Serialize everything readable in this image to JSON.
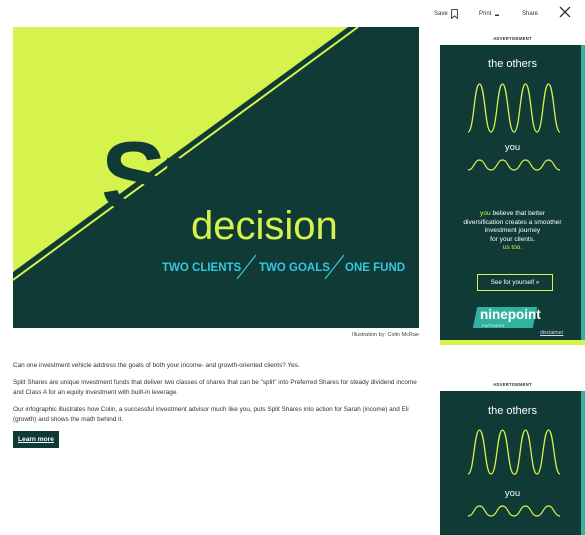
{
  "toolbar": {
    "save_label": "Save",
    "print_label": "Print",
    "share_label": "Share",
    "save_icon": "bookmark-icon",
    "print_icon": "print-icon",
    "x_icon": "x-logo-icon"
  },
  "hero": {
    "title_word_1": "Split",
    "title_word_2": "decision",
    "tagline_1": "TWO CLIENTS",
    "tagline_2": "TWO GOALS",
    "tagline_3": "ONE FUND",
    "caption": "Illustration by: Colin McRae"
  },
  "article": {
    "paragraph_1": "Can one investment vehicle address the goals of both your income- and growth-oriented clients? Yes.",
    "paragraph_2": "Split Shares are unique investment funds that deliver two classes of shares that can be \"split\" into Preferred Shares for steady dividend income and Class A for an equity investment with built-in leverage.",
    "paragraph_3": "Our infographic illustrates how Colin, a successful investment advisor much like you, puts Split Shares into action for Sarah (income) and Eli (growth) and shows the math behind it.",
    "learn_more_label": "Learn more"
  },
  "ads": [
    {
      "label": "ADVERTISEMENT",
      "headline": "the others",
      "you": "you",
      "body_highlight": "you",
      "body_line_1": " believe that better",
      "body_line_2": "diversification creates a smoother",
      "body_line_3": "investment journey",
      "body_line_4": "for your clients.",
      "us_too": "us too.",
      "cta_label": "See for yourself »",
      "logo_text": "ninepoint",
      "logo_sub": "PARTNERS",
      "disclaimer_label": "disclaimer"
    },
    {
      "label": "ADVERTISEMENT",
      "headline": "the others",
      "you": "you"
    }
  ],
  "colors": {
    "dark_green": "#0f3a35",
    "lime": "#d6f24c",
    "teal": "#34b0a0",
    "cyan_text": "#36c6e0"
  }
}
